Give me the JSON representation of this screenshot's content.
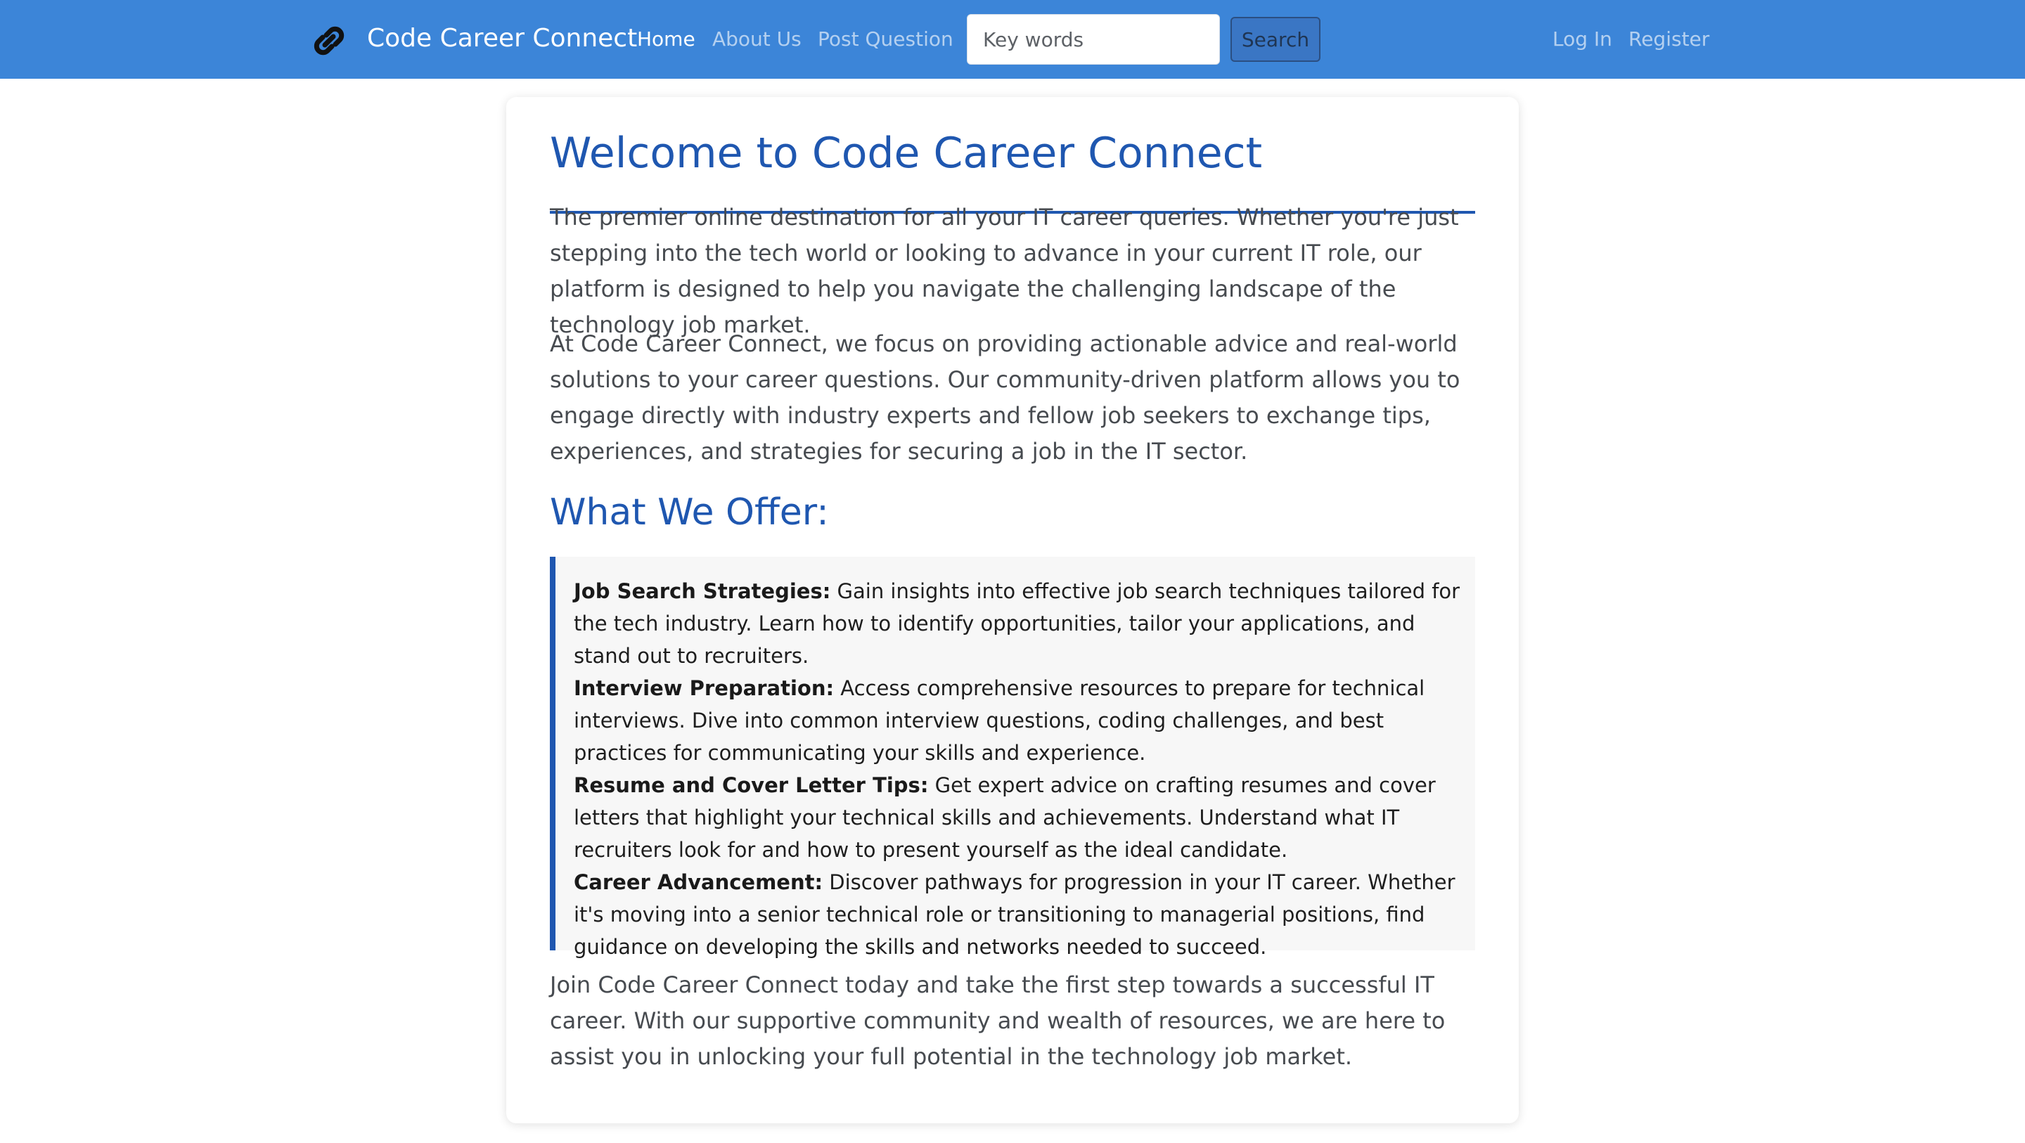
{
  "nav": {
    "brand": "Code Career Connect",
    "logo_icon": "link-icon",
    "links": [
      "Home",
      "About Us",
      "Post Question"
    ],
    "search_placeholder": "Key words",
    "search_button": "Search",
    "login": "Log In",
    "register": "Register"
  },
  "colors": {
    "navbar": "#3c85d8",
    "heading": "#1f57b0",
    "offer_background": "#f7f7f7"
  },
  "main": {
    "title": "Welcome to Code Career Connect",
    "intro": "The premier online destination for all your IT career queries. Whether you're just stepping into the tech world or looking to advance in your current IT role, our platform is designed to help you navigate the challenging landscape of the technology job market.",
    "focus": "At Code Career Connect, we focus on providing actionable advice and real-world solutions to your career questions. Our community-driven platform allows you to engage directly with industry experts and fellow job seekers to exchange tips, experiences, and strategies for securing a job in the IT sector.",
    "offer_title": "What We Offer:",
    "offers": [
      {
        "title": "Job Search Strategies:",
        "text": "Gain insights into effective job search techniques tailored for the tech industry. Learn how to identify opportunities, tailor your applications, and stand out to recruiters."
      },
      {
        "title": "Interview Preparation:",
        "text": "Access comprehensive resources to prepare for technical interviews. Dive into common interview questions, coding challenges, and best practices for communicating your skills and experience."
      },
      {
        "title": "Resume and Cover Letter Tips:",
        "text": "Get expert advice on crafting resumes and cover letters that highlight your technical skills and achievements. Understand what IT recruiters look for and how to present yourself as the ideal candidate."
      },
      {
        "title": "Career Advancement:",
        "text": "Discover pathways for progression in your IT career. Whether it's moving into a senior technical role or transitioning to managerial positions, find guidance on developing the skills and networks needed to succeed."
      }
    ],
    "closing": "Join Code Career Connect today and take the first step towards a successful IT career. With our supportive community and wealth of resources, we are here to assist you in unlocking your full potential in the technology job market."
  }
}
